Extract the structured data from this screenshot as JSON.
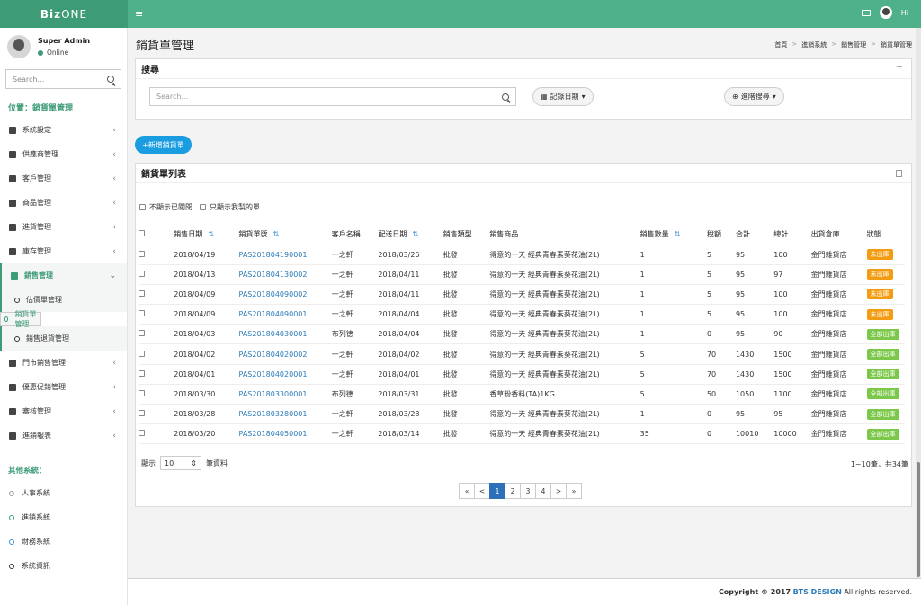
{
  "app": {
    "logo_bold": "Biz",
    "logo_light": "ONE",
    "hamburger": "≡",
    "hi": "Hi"
  },
  "user": {
    "name": "Super Admin",
    "status": "Online"
  },
  "sidebar": {
    "search_placeholder": "Search...",
    "location": "位置：銷貨單管理",
    "items": [
      {
        "label": "系統設定",
        "chev": "‹"
      },
      {
        "label": "供應商管理",
        "chev": "‹"
      },
      {
        "label": "客戶管理",
        "chev": "‹"
      },
      {
        "label": "商品管理",
        "chev": "‹"
      },
      {
        "label": "進貨管理",
        "chev": "‹"
      },
      {
        "label": "庫存管理",
        "chev": "‹"
      },
      {
        "label": "銷售管理",
        "chev": "⌄"
      }
    ],
    "sub_items": [
      "估價單管理",
      "銷貨單管理",
      "銷售退貨管理"
    ],
    "items2": [
      {
        "label": "門市銷售管理",
        "chev": "‹"
      },
      {
        "label": "優惠促銷管理",
        "chev": "‹"
      },
      {
        "label": "審核管理",
        "chev": "‹"
      },
      {
        "label": "進銷報表",
        "chev": "‹"
      }
    ],
    "other_title": "其他系統：",
    "other_items": [
      "人事系統",
      "進銷系統",
      "財務系統",
      "系統資訊"
    ]
  },
  "page": {
    "title": "銷貨單管理",
    "breadcrumb": [
      "首頁",
      "進銷系統",
      "銷售管理",
      "銷貨單管理"
    ],
    "bc_sep": ">"
  },
  "search_box": {
    "title": "搜尋",
    "collapse": "−",
    "placeholder": "Search...",
    "date_btn": "記錄日期",
    "adv_btn": "進階搜尋",
    "caret": "▾"
  },
  "add_button": "+新增銷貨單",
  "list": {
    "title": "銷貨單列表",
    "filter1": "不顯示已關閉",
    "filter2": "只顯示我製的單",
    "columns": [
      "銷售日期",
      "銷貨單號",
      "客戶名稱",
      "配送日期",
      "銷售類型",
      "銷售商品",
      "銷售數量",
      "稅額",
      "合計",
      "總計",
      "出貨倉庫",
      "狀態"
    ],
    "sort_icon": "⇅",
    "rows": [
      {
        "date": "2018/04/19",
        "no": "PAS201804190001",
        "customer": "一之軒",
        "ship": "2018/03/26",
        "type": "批發",
        "product": "得意的一天 經典青春素葵花油(2L)",
        "qty": "1",
        "tax": "5",
        "sum": "95",
        "total": "100",
        "wh": "金門雜貨店",
        "status": "未出庫",
        "status_color": "orange"
      },
      {
        "date": "2018/04/13",
        "no": "PAS201804130002",
        "customer": "一之軒",
        "ship": "2018/04/11",
        "type": "批發",
        "product": "得意的一天 經典青春素葵花油(2L)",
        "qty": "1",
        "tax": "5",
        "sum": "95",
        "total": "97",
        "wh": "金門雜貨店",
        "status": "未出庫",
        "status_color": "orange"
      },
      {
        "date": "2018/04/09",
        "no": "PAS201804090002",
        "customer": "一之軒",
        "ship": "2018/04/11",
        "type": "批發",
        "product": "得意的一天 經典青春素葵花油(2L)",
        "qty": "1",
        "tax": "5",
        "sum": "95",
        "total": "100",
        "wh": "金門雜貨店",
        "status": "未出庫",
        "status_color": "orange"
      },
      {
        "date": "2018/04/09",
        "no": "PAS201804090001",
        "customer": "一之軒",
        "ship": "2018/04/04",
        "type": "批發",
        "product": "得意的一天 經典青春素葵花油(2L)",
        "qty": "1",
        "tax": "5",
        "sum": "95",
        "total": "100",
        "wh": "金門雜貨店",
        "status": "未出庫",
        "status_color": "orange"
      },
      {
        "date": "2018/04/03",
        "no": "PAS201804030001",
        "customer": "布列德",
        "ship": "2018/04/04",
        "type": "批發",
        "product": "得意的一天 經典青春素葵花油(2L)",
        "qty": "1",
        "tax": "0",
        "sum": "95",
        "total": "90",
        "wh": "金門雜貨店",
        "status": "全部出庫",
        "status_color": "green"
      },
      {
        "date": "2018/04/02",
        "no": "PAS201804020002",
        "customer": "一之軒",
        "ship": "2018/04/02",
        "type": "批發",
        "product": "得意的一天 經典青春素葵花油(2L)",
        "qty": "5",
        "tax": "70",
        "sum": "1430",
        "total": "1500",
        "wh": "金門雜貨店",
        "status": "全部出庫",
        "status_color": "green"
      },
      {
        "date": "2018/04/01",
        "no": "PAS201804020001",
        "customer": "一之軒",
        "ship": "2018/04/01",
        "type": "批發",
        "product": "得意的一天 經典青春素葵花油(2L)",
        "qty": "5",
        "tax": "70",
        "sum": "1430",
        "total": "1500",
        "wh": "金門雜貨店",
        "status": "全部出庫",
        "status_color": "green"
      },
      {
        "date": "2018/03/30",
        "no": "PAS201803300001",
        "customer": "布列德",
        "ship": "2018/03/31",
        "type": "批發",
        "product": "香草粉香料(TA)1KG",
        "qty": "5",
        "tax": "50",
        "sum": "1050",
        "total": "1100",
        "wh": "金門雜貨店",
        "status": "全部出庫",
        "status_color": "green"
      },
      {
        "date": "2018/03/28",
        "no": "PAS201803280001",
        "customer": "一之軒",
        "ship": "2018/03/28",
        "type": "批發",
        "product": "得意的一天 經典青春素葵花油(2L)",
        "qty": "1",
        "tax": "0",
        "sum": "95",
        "total": "95",
        "wh": "金門雜貨店",
        "status": "全部出庫",
        "status_color": "green"
      },
      {
        "date": "2018/03/20",
        "no": "PAS201804050001",
        "customer": "一之軒",
        "ship": "2018/03/14",
        "type": "批發",
        "product": "得意的一天 經典青春素葵花油(2L)",
        "qty": "35",
        "tax": "0",
        "sum": "10010",
        "total": "10000",
        "wh": "金門雜貨店",
        "status": "全部出庫",
        "status_color": "green"
      }
    ],
    "show_label": "顯示",
    "page_size": "10",
    "records_label": "筆資料",
    "total_text": "1~10筆，共34筆",
    "pager": [
      "«",
      "<",
      "1",
      "2",
      "3",
      "4",
      ">",
      "»"
    ],
    "current_page": "1"
  },
  "footer": {
    "prefix": "Copyright © 2017",
    "brand": "BTS DESIGN",
    "suffix": "All rights reserved."
  },
  "colors": {
    "brand": "#4fb18a",
    "accent": "#3d9b76",
    "primary": "#1a9de0",
    "orange": "#f39c12",
    "green": "#7cc84a"
  }
}
